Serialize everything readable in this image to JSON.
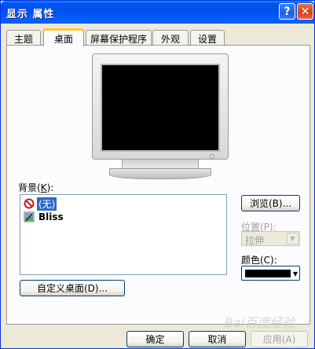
{
  "window": {
    "title": "显示 属性",
    "help_glyph": "?",
    "close_glyph": "✕"
  },
  "tabs": [
    {
      "label": "主题"
    },
    {
      "label": "桌面"
    },
    {
      "label": "屏幕保护程序"
    },
    {
      "label": "外观"
    },
    {
      "label": "设置"
    }
  ],
  "background": {
    "label_main": "背景(",
    "label_key": "K",
    "label_end": "):",
    "items": [
      {
        "label": "(无)",
        "icon": "none-icon",
        "selected": true
      },
      {
        "label": "Bliss",
        "icon": "bliss-icon",
        "selected": false
      }
    ]
  },
  "browse_button": "浏览(B)...",
  "position": {
    "label": "位置(P):",
    "value": "拉伸"
  },
  "color": {
    "label": "颜色(C):",
    "value": "#000000"
  },
  "customize_button": "自定义桌面(D)...",
  "footer": {
    "ok": "确定",
    "cancel": "取消",
    "apply": "应用(A)"
  },
  "watermark": "Bai百度经验"
}
